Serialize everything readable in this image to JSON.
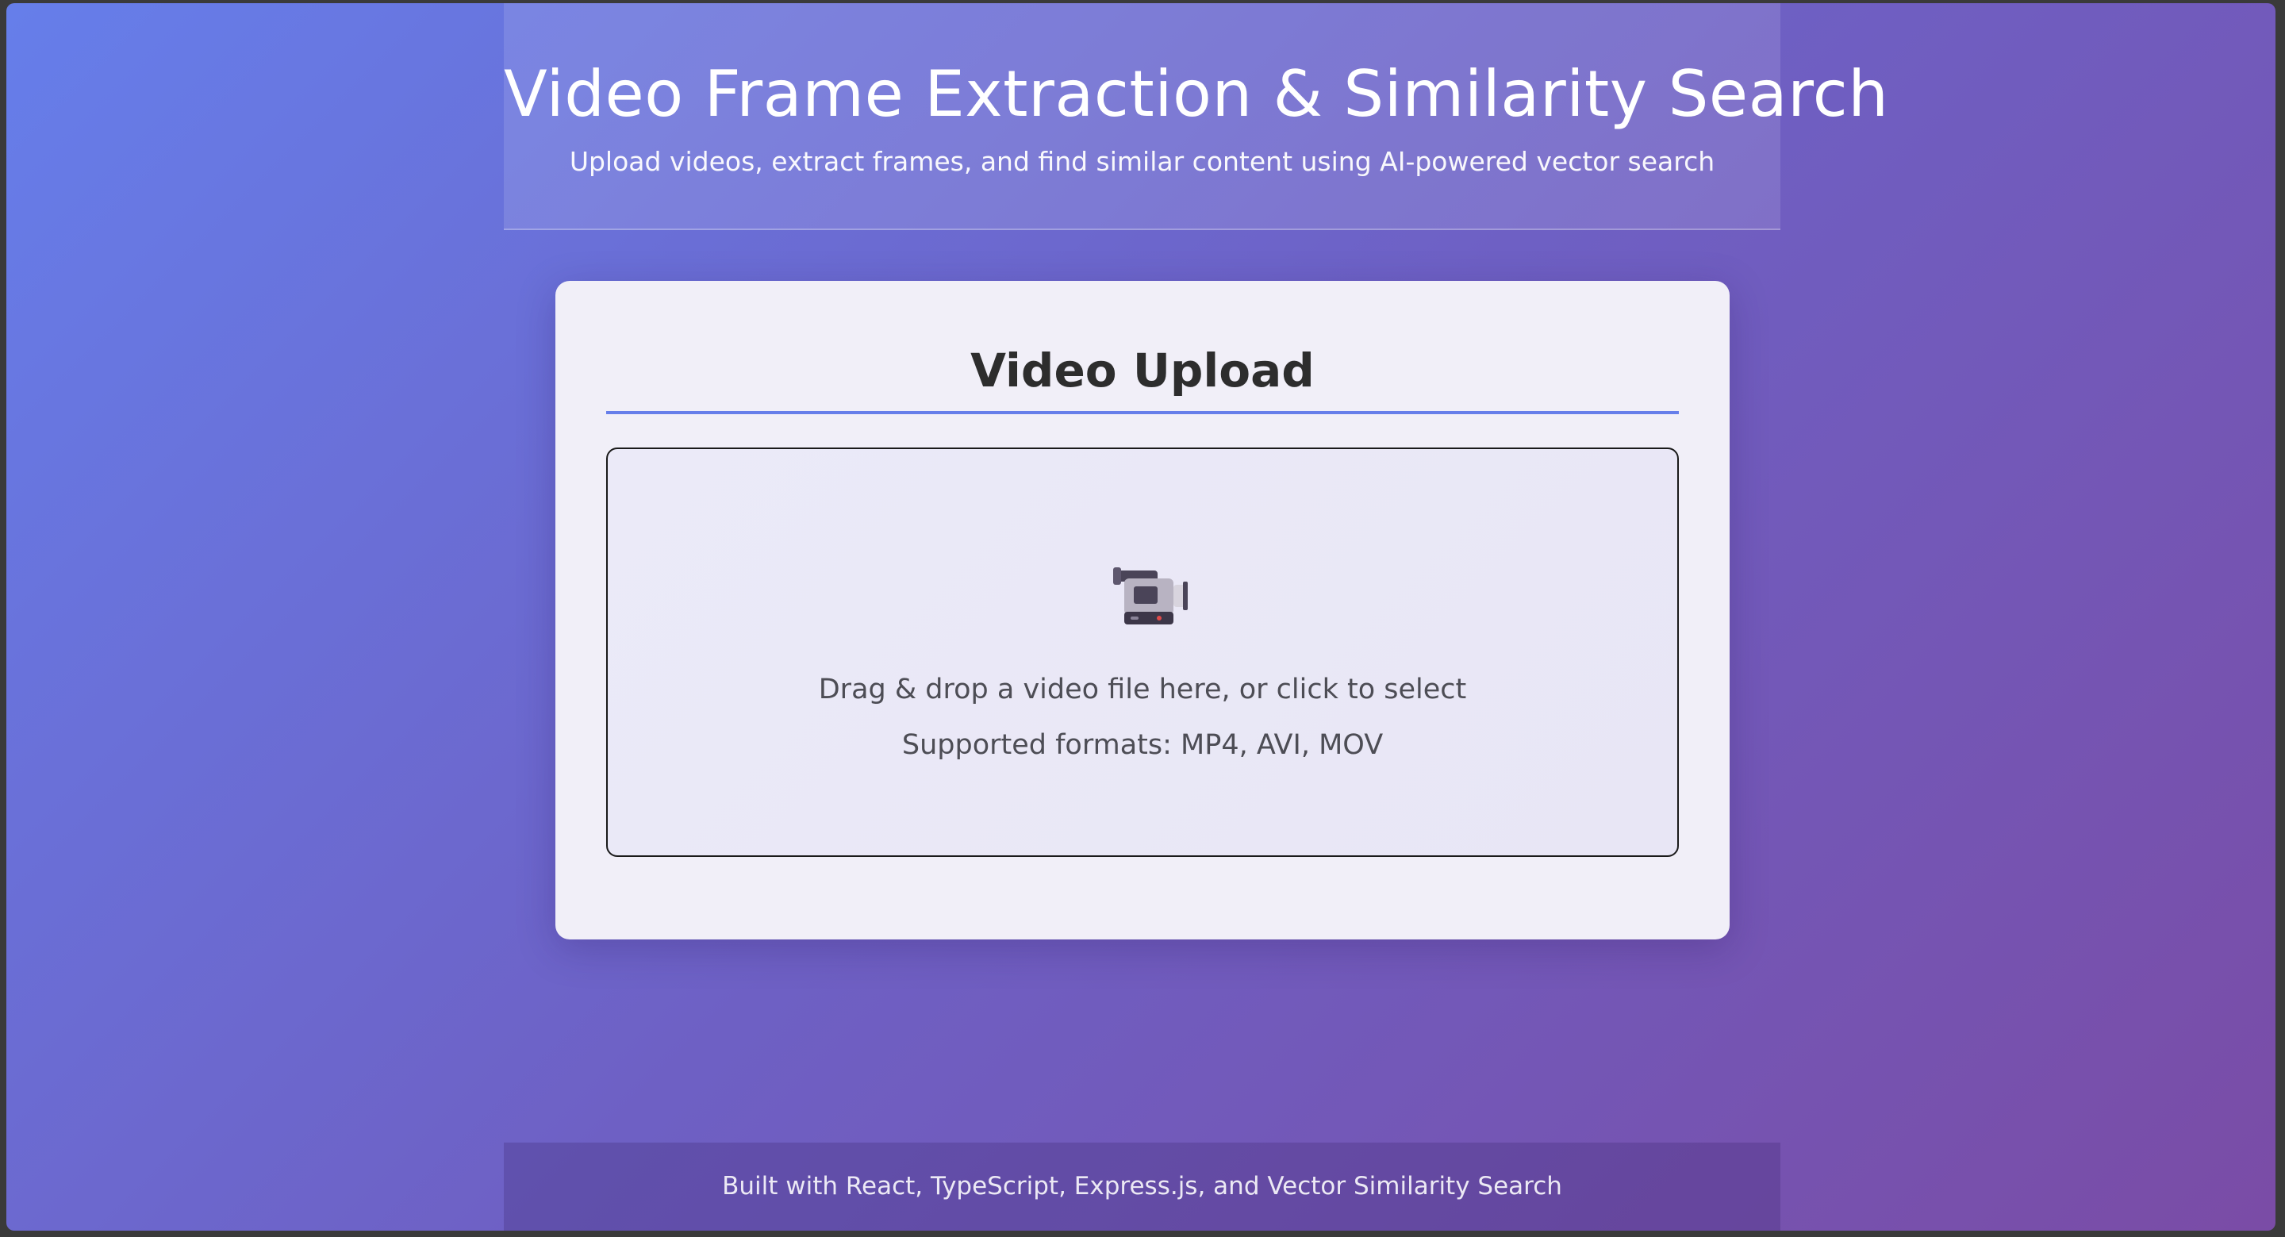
{
  "header": {
    "title": "Video Frame Extraction & Similarity Search",
    "subtitle": "Upload videos, extract frames, and find similar content using AI-powered vector search"
  },
  "upload": {
    "title": "Video Upload",
    "icon": "video-camera-icon",
    "instructions": "Drag & drop a video file here, or click to select",
    "formats": "Supported formats: MP4, AVI, MOV"
  },
  "footer": {
    "text": "Built with React, TypeScript, Express.js, and Vector Similarity Search"
  },
  "colors": {
    "background_start": "#667eea",
    "background_end": "#764ba2",
    "accent": "#667eea",
    "card": "#f1eff8"
  }
}
